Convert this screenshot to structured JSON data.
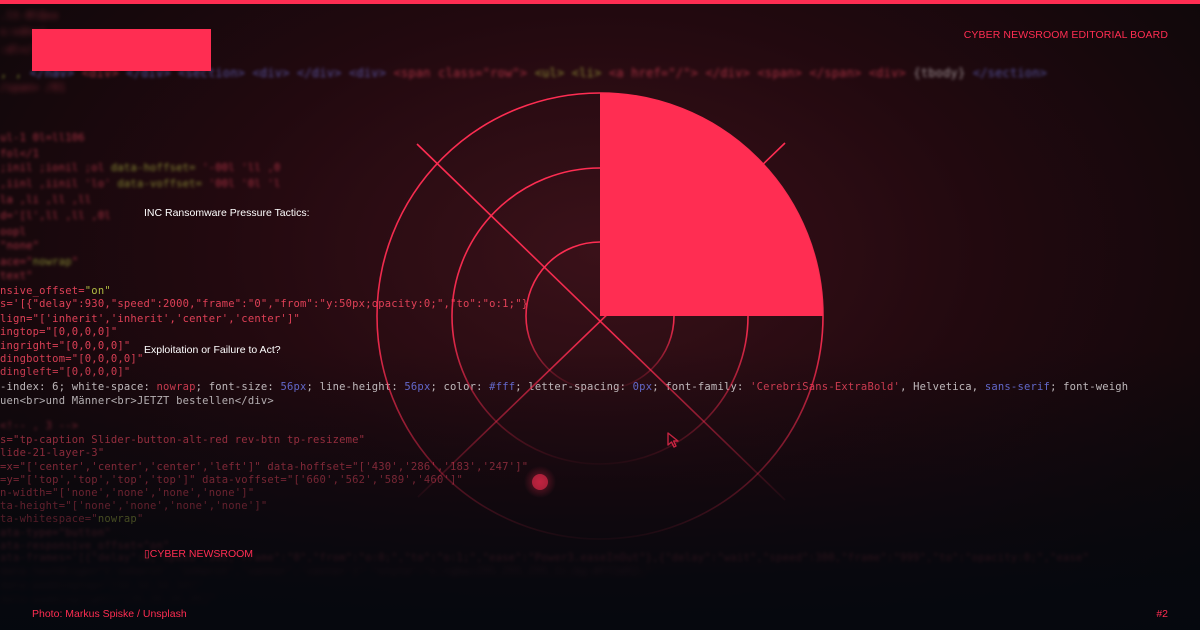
{
  "header": {
    "board_label": "CYBER NEWSROOM EDITORIAL BOARD"
  },
  "headlines": [
    "INC Ransomware Pressure Tactics:",
    "Exploitation or Failure to Act?"
  ],
  "brand_label": "CYBER NEWSROOM",
  "footer": {
    "credit": "Photo: Markus Spiske / Unsplash",
    "page_number": "#2"
  },
  "background_code": [
    "Y_tx=\"['center','center','center','left']\" data-hoffset=\"['430','286','183','247']\"",
    "=\"['top','top','top','top']\" data-voffset=\"['660','562','589','460']\"",
    "n-width=\"['none','none','none','none']\"",
    "ta-height=\"['none','none','none','none']\"",
    "ta-whitespace=\"nowrap\"",
    "ata-type=\"button\"",
    "ata-responsive_offset=\"on\"",
    "=\"tp-caption Slider-button-alt-red rev-btn tp-resizeme\"",
    "lide-21-layer-3\"",
    "-index: 6; white-space: nowrap; font-size: 56px; line-height: 56px; color: #fff; letter-spacing: 0px; font-family: 'CerebriSans-ExtraBold', Helvetica, sans-serif;",
    "uen<br>und Männer<br>JETZT bestellen</div>",
    "s='[{\"delay\":930,\"speed\":2000,\"frame\":\"0\",\"from\":\"y:50px;opacity:0;\",\"to\":\"o:1;\"}",
    "lign=\"['inherit','inherit','center','center']\"",
    "ingtop=\"[0,0,0,0]\"",
    "ingright=\"[0,0,0,0]\"",
    "dingbottom=\"[0,0,0,0]\"",
    "dingleft=\"[0,0,0,0]\"",
    "nsive_offset=\"on\"",
    "data-hoffset",
    "nowrap",
    "text"
  ],
  "colors": {
    "accent": "#ff2d52",
    "background": "#1a0a0e",
    "text_light": "#ffffff"
  },
  "graphic": {
    "shape": "radar / target with filled quarter sector",
    "icons": [
      "cursor-icon",
      "radar-blip-icon"
    ]
  }
}
